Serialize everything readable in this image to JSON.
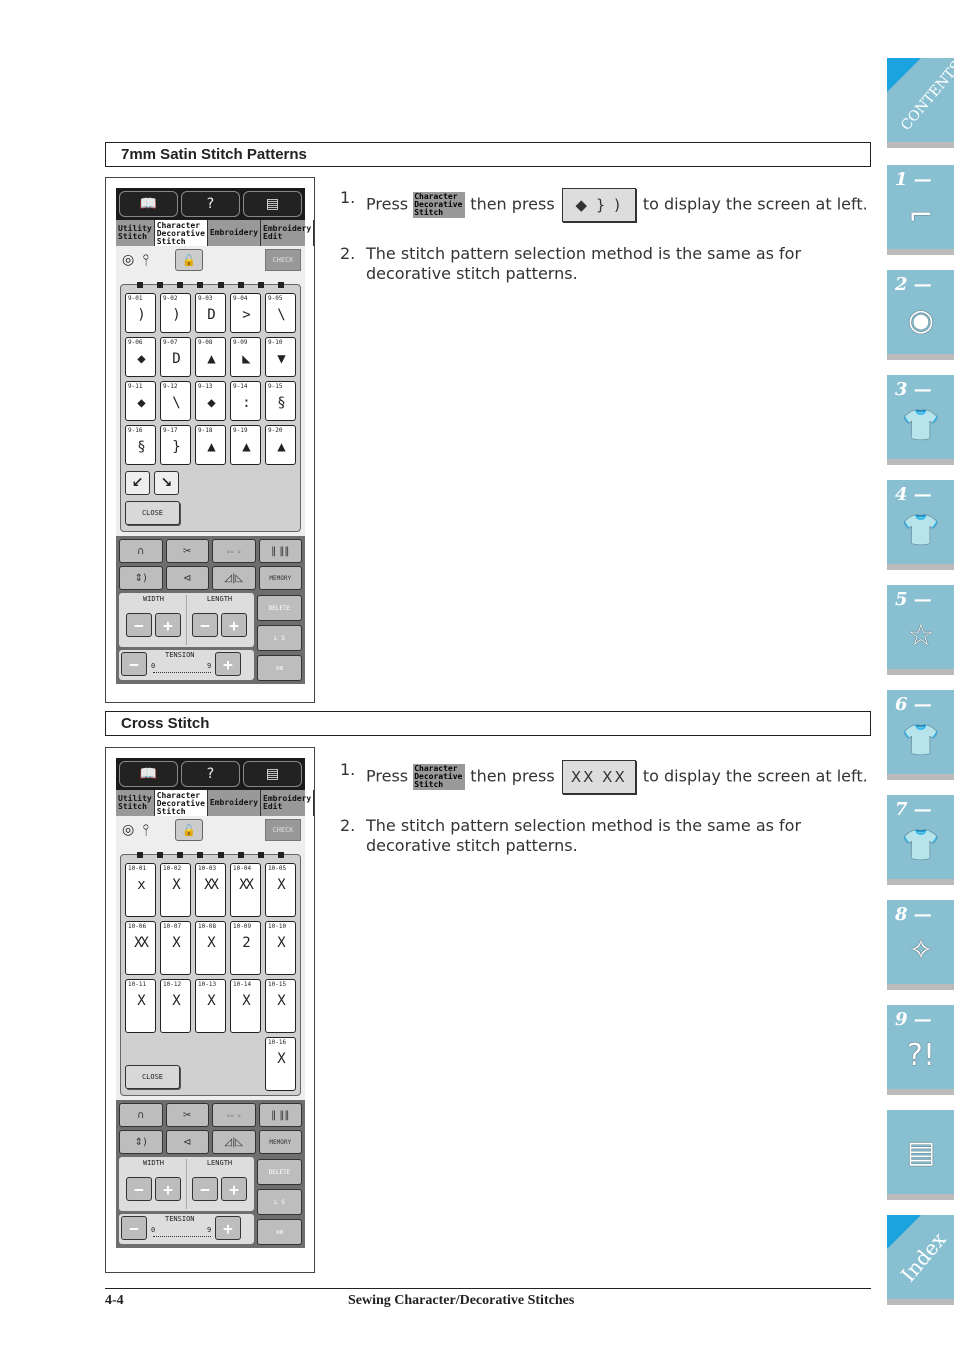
{
  "sections": [
    {
      "title": "7mm Satin Stitch Patterns",
      "steps": [
        {
          "num": "1.",
          "pre": "Press",
          "key": "Character Decorative Stitch",
          "mid": "then press",
          "btn_glyph": "◆ } )",
          "post": "to display the screen at left."
        },
        {
          "num": "2.",
          "text": "The stitch pattern selection method is the same as for decorative stitch patterns."
        }
      ],
      "screen": {
        "tabs": [
          "Utility Stitch",
          "Character Decorative Stitch",
          "Embroidery",
          "Embroidery Edit"
        ],
        "check_label": "CHECK",
        "patterns": [
          "9-01",
          "9-02",
          "9-03",
          "9-04",
          "9-05",
          "9-06",
          "9-07",
          "9-08",
          "9-09",
          "9-10",
          "9-11",
          "9-12",
          "9-13",
          "9-14",
          "9-15",
          "9-16",
          "9-17",
          "9-18",
          "9-19",
          "9-20"
        ],
        "glyphs": [
          ")",
          ")",
          "D",
          ">",
          "\\",
          "◆",
          "D",
          "▲",
          "◣",
          "▼",
          "◆",
          "\\",
          "◆",
          ":",
          "§",
          "§",
          "}",
          "▲",
          "▲",
          "▲"
        ],
        "close_label": "CLOSE",
        "width_label": "WIDTH",
        "length_label": "LENGTH",
        "tension_label": "TENSION",
        "tension_min": "0",
        "tension_max": "9",
        "memory_label": "MEMORY",
        "delete_label": "DELETE",
        "ls_label": "L  S"
      }
    },
    {
      "title": "Cross Stitch",
      "steps": [
        {
          "num": "1.",
          "pre": "Press",
          "key": "Character Decorative Stitch",
          "mid": "then press",
          "btn_glyph": "XX XX",
          "post": "to display the screen at left."
        },
        {
          "num": "2.",
          "text": "The stitch pattern selection method is the same as for decorative stitch patterns."
        }
      ],
      "screen": {
        "tabs": [
          "Utility Stitch",
          "Character Decorative Stitch",
          "Embroidery",
          "Embroidery Edit"
        ],
        "check_label": "CHECK",
        "patterns": [
          "10-01",
          "10-02",
          "10-03",
          "10-04",
          "10-05",
          "10-06",
          "10-07",
          "10-08",
          "10-09",
          "10-10",
          "10-11",
          "10-12",
          "10-13",
          "10-14",
          "10-15",
          "10-16"
        ],
        "glyphs": [
          "x",
          "X",
          "XX",
          "XX",
          "X",
          "XX",
          "X",
          "X",
          "2",
          "X",
          "X",
          "X",
          "X",
          "X",
          "X",
          "X"
        ],
        "close_label": "CLOSE",
        "width_label": "WIDTH",
        "length_label": "LENGTH",
        "tension_label": "TENSION",
        "tension_min": "0",
        "tension_max": "9",
        "memory_label": "MEMORY",
        "delete_label": "DELETE",
        "ls_label": "L  S"
      }
    }
  ],
  "side_tabs": [
    {
      "label": "CONTENTS",
      "icon": "contents-icon"
    },
    {
      "label": "1 —",
      "icon": "sewing-machine-icon"
    },
    {
      "label": "2 —",
      "icon": "thread-spool-icon"
    },
    {
      "label": "3 —",
      "icon": "shirt-icon"
    },
    {
      "label": "4 —",
      "icon": "shirt-abc-icon"
    },
    {
      "label": "5 —",
      "icon": "embroidery-hoop-icon"
    },
    {
      "label": "6 —",
      "icon": "shirt-edit-icon"
    },
    {
      "label": "7 —",
      "icon": "shirt-pen-icon"
    },
    {
      "label": "8 —",
      "icon": "machine-care-icon"
    },
    {
      "label": "9 —",
      "icon": "machine-trouble-icon"
    },
    {
      "label": "",
      "icon": "pages-icon"
    },
    {
      "label": "Index",
      "icon": "index-icon"
    }
  ],
  "footer": {
    "page": "4-4",
    "title": "Sewing Character/Decorative Stitches"
  }
}
